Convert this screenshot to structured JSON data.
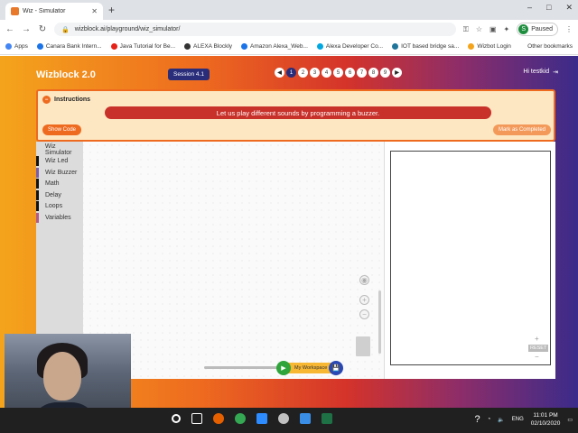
{
  "browser": {
    "tab_title": "Wiz - Simulator",
    "url": "wizblock.ai/playground/wiz_simulator/",
    "profile_initial": "S",
    "profile_status": "Paused",
    "new_tab_glyph": "+",
    "window_controls": [
      "–",
      "□",
      "✕"
    ]
  },
  "bookmarks": [
    {
      "label": "Apps",
      "color": "#4285f4"
    },
    {
      "label": "Canara Bank Intern...",
      "color": "#1a73e8"
    },
    {
      "label": "Java Tutorial for Be...",
      "color": "#e62117"
    },
    {
      "label": "ALEXA Blockly",
      "color": "#333333"
    },
    {
      "label": "Amazon Alexa_Web...",
      "color": "#1a73e8"
    },
    {
      "label": "Alexa Developer Co...",
      "color": "#00a8e1"
    },
    {
      "label": "IOT based bridge sa...",
      "color": "#21759b"
    },
    {
      "label": "Wizbot Login",
      "color": "#f4a41c"
    }
  ],
  "bookmarks_other": "Other bookmarks",
  "app": {
    "brand": "Wizblock 2.0",
    "session": "Session 4.1",
    "pages": [
      "1",
      "2",
      "3",
      "4",
      "5",
      "6",
      "7",
      "8",
      "9"
    ],
    "active_page": "1",
    "greeting": "Hi testkid"
  },
  "instructions": {
    "heading": "Instructions",
    "message": "Let us play different sounds by programming a buzzer.",
    "show_code": "Show Code",
    "mark_completed": "Mark as Completed"
  },
  "toolbox": [
    {
      "label": "Wiz Simulator",
      "color": "#dcdcdc"
    },
    {
      "label": "Wiz Led",
      "color": "#111111"
    },
    {
      "label": "Wiz Buzzer",
      "color": "#7b5ea7"
    },
    {
      "label": "Math",
      "color": "#111111"
    },
    {
      "label": "Delay",
      "color": "#111111"
    },
    {
      "label": "Loops",
      "color": "#111111"
    },
    {
      "label": "Variables",
      "color": "#b05a88"
    }
  ],
  "runbar": {
    "my_workspace": "My Workspace",
    "run_glyph": "▶",
    "save_glyph": "💾"
  },
  "simulator": {
    "reset_label": "RESET",
    "zoom_in": "+",
    "zoom_out": "−"
  },
  "taskbar": {
    "time": "11:01 PM",
    "date": "02/10/2020",
    "lang": "ENG"
  }
}
